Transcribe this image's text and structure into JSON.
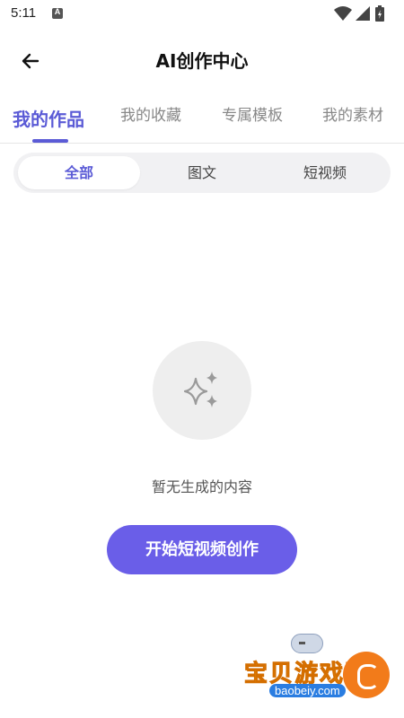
{
  "status": {
    "time": "5:11",
    "notification_letter": "A"
  },
  "header": {
    "title": "AI创作中心"
  },
  "tabs": [
    {
      "label": "我的作品"
    },
    {
      "label": "我的收藏"
    },
    {
      "label": "专属模板"
    },
    {
      "label": "我的素材"
    }
  ],
  "filter": {
    "items": [
      {
        "label": "全部"
      },
      {
        "label": "图文"
      },
      {
        "label": "短视频"
      }
    ]
  },
  "empty_state": {
    "message": "暂无生成的内容",
    "icon": "sparkle-icon"
  },
  "cta": {
    "label": "开始短视频创作"
  },
  "watermark": {
    "text": "宝贝游戏网",
    "url": "baobeiy.com"
  },
  "colors": {
    "accent": "#5b5bd6",
    "button": "#6a5ee8"
  }
}
